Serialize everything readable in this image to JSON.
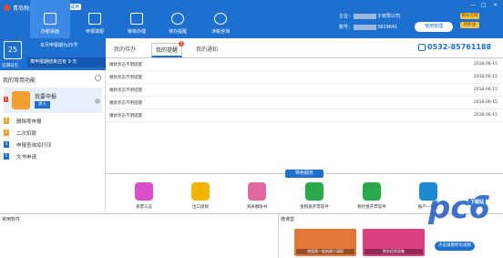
{
  "app": {
    "title": "青岛税务免费客户端",
    "version_badge": "试用",
    "window_controls": [
      "—",
      "□",
      "×"
    ]
  },
  "nav": [
    {
      "label": "办税桌面",
      "icon": "home-icon",
      "active": true
    },
    {
      "label": "申报填报",
      "icon": "form-icon",
      "active": false
    },
    {
      "label": "审核办理",
      "icon": "audit-icon",
      "active": false
    },
    {
      "label": "待办提醒",
      "icon": "person-icon",
      "active": false
    },
    {
      "label": "涉税咨询",
      "icon": "chat-icon",
      "active": false
    }
  ],
  "user": {
    "company_label": "企业：",
    "company_suffix": "子有限公司",
    "tax_label": "税号：",
    "tax_suffix": "3819641",
    "account_button": "使用管理",
    "link1": "税局官网",
    "link2": "税税通"
  },
  "calendar": {
    "day": "25",
    "label": "征期日历",
    "deadline": "本月申报期为25号",
    "remain": "离申报期结束还有 9 天"
  },
  "common_funcs": {
    "title": "我的常用功能",
    "featured": {
      "badge": "1",
      "label": "我要申报",
      "enter": "进入"
    },
    "items": [
      {
        "num": "2",
        "label": "删除零申报",
        "color": "#f0a030"
      },
      {
        "num": "3",
        "label": "二次扣款",
        "color": "#f0a030"
      },
      {
        "num": "4",
        "label": "申报查询及打印",
        "color": "#1d6fd0"
      },
      {
        "num": "5",
        "label": "文书申请",
        "color": "#1d6fd0"
      }
    ]
  },
  "tabs": [
    {
      "label": "我的待办",
      "active": false
    },
    {
      "label": "我的提醒",
      "active": true,
      "count": "5"
    },
    {
      "label": "我的通知",
      "active": false
    }
  ],
  "hotline": "0532-85761188",
  "messages": [
    {
      "text": "缴款状态不明提醒",
      "date": "2018-06-15"
    },
    {
      "text": "缴款状态不明提醒",
      "date": "2018-06-15"
    },
    {
      "text": "缴款状态不明提醒",
      "date": "2018-06-15"
    },
    {
      "text": "缴款状态不明提醒",
      "date": "2018-06-15"
    },
    {
      "text": "缴款状态不明提醒",
      "date": "2018-06-15"
    }
  ],
  "biz_section": {
    "title": "特色服务"
  },
  "biz_items": [
    {
      "label": "发票认证",
      "color": "#d94fc8"
    },
    {
      "label": "出口退税",
      "color": "#f0b400"
    },
    {
      "label": "海关缴款书",
      "color": "#e06aa0"
    },
    {
      "label": "金税盘开票软件",
      "color": "#2aa84a"
    },
    {
      "label": "税控盘开票软件",
      "color": "#2aa84a"
    },
    {
      "label": "报产一体化",
      "color": "#1d8ad0"
    }
  ],
  "bottom": {
    "common_software": "常用软件",
    "micro_class": "微课堂",
    "videos": [
      {
        "text": "增值税一般纳税人填报",
        "color": "#e3773a"
      },
      {
        "text": "税务信息采集",
        "color": "#d94080"
      }
    ],
    "more_button": "点击观看所有视频"
  },
  "watermark": {
    "text": "pc6",
    "sub": "下载站"
  }
}
